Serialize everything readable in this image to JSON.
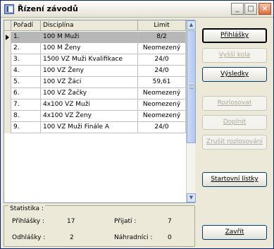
{
  "window": {
    "title": "Řízení závodů"
  },
  "table": {
    "columns": [
      "Pořadí",
      "Disciplína",
      "Limit"
    ],
    "rows": [
      {
        "poradi": "1.",
        "disciplina": "100 M Muži",
        "limit": "8/2"
      },
      {
        "poradi": "2.",
        "disciplina": "100 M Ženy",
        "limit": "Neomezený"
      },
      {
        "poradi": "3.",
        "disciplina": "1500 VZ Muži Kvalifikace",
        "limit": "24/0"
      },
      {
        "poradi": "4.",
        "disciplina": "100 VZ Ženy",
        "limit": "24/0"
      },
      {
        "poradi": "5.",
        "disciplina": "100 VZ Žáci",
        "limit": "59,61"
      },
      {
        "poradi": "6.",
        "disciplina": "100 VZ Žačky",
        "limit": "Neomezený"
      },
      {
        "poradi": "7.",
        "disciplina": "4x100 VZ Muži",
        "limit": "Neomezený"
      },
      {
        "poradi": "8.",
        "disciplina": "4x100 VZ Ženy",
        "limit": "Neomezený"
      },
      {
        "poradi": "9.",
        "disciplina": "100 VZ Muži Finále A",
        "limit": "24/0"
      }
    ]
  },
  "stats": {
    "legend": "Statistika :",
    "prihlasky_label": "Přihlášky :",
    "prihlasky_value": "17",
    "prijati_label": "Přijatí :",
    "prijati_value": "7",
    "odhlasky_label": "Odhlášky :",
    "odhlasky_value": "2",
    "nahradnici_label": "Náhradníci :",
    "nahradnici_value": "0"
  },
  "buttons": {
    "prihlasky": "Přihlášky",
    "vyssi_kolo": "Vyšší kola",
    "vysledky": "Výsledky",
    "rozlosovat": "Rozlosovat",
    "doplnit": "Doplnit",
    "zrusit": "Zrušit rozlosování",
    "startovni": "Startovní lístky",
    "zavrit": "Zavřít"
  }
}
